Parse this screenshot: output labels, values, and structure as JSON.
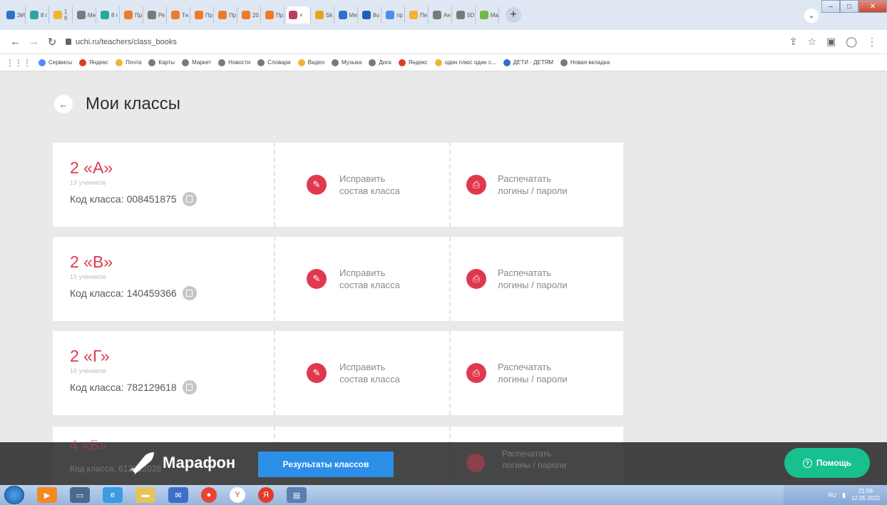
{
  "browser": {
    "tabs": [
      {
        "label": "ЭИ",
        "color": "#2f6fd0"
      },
      {
        "label": "8 г",
        "color": "#2aa6a0"
      },
      {
        "label": "1 б",
        "color": "#f2b233"
      },
      {
        "label": "Ме",
        "color": "#7a7a7a"
      },
      {
        "label": "8 г",
        "color": "#2aa6a0"
      },
      {
        "label": "Пр",
        "color": "#f07a28"
      },
      {
        "label": "Ре",
        "color": "#7a7a7a"
      },
      {
        "label": "Тн",
        "color": "#f07a28"
      },
      {
        "label": "Пр",
        "color": "#f07a28"
      },
      {
        "label": "Пр",
        "color": "#f07a28"
      },
      {
        "label": "20",
        "color": "#f07a28"
      },
      {
        "label": "Пр",
        "color": "#f07a28"
      },
      {
        "label": "×",
        "color": "#c23b5a"
      },
      {
        "label": "Sk",
        "color": "#e6a51d"
      },
      {
        "label": "Ме",
        "color": "#2f6fd0"
      },
      {
        "label": "8о",
        "color": "#1f5fb5"
      },
      {
        "label": "пр",
        "color": "#4c8df0"
      },
      {
        "label": "Пе",
        "color": "#f2b233"
      },
      {
        "label": "Ан",
        "color": "#7a7a7a"
      },
      {
        "label": "5D",
        "color": "#7a7a7a"
      },
      {
        "label": "Ма",
        "color": "#74b843"
      }
    ],
    "url": "uchi.ru/teachers/class_books",
    "bookmarks": [
      {
        "label": "Сервисы",
        "color": "#4c8df0"
      },
      {
        "label": "Яндекс",
        "color": "#e03a2b"
      },
      {
        "label": "Почта",
        "color": "#f2b233"
      },
      {
        "label": "Карты",
        "color": "#7a7a7a"
      },
      {
        "label": "Маркет",
        "color": "#7a7a7a"
      },
      {
        "label": "Новости",
        "color": "#7a7a7a"
      },
      {
        "label": "Словари",
        "color": "#7a7a7a"
      },
      {
        "label": "Видео",
        "color": "#f2b233"
      },
      {
        "label": "Музыка",
        "color": "#7a7a7a"
      },
      {
        "label": "Диск",
        "color": "#7a7a7a"
      },
      {
        "label": "Яндекс",
        "color": "#e03a2b"
      },
      {
        "label": "один плюс один с...",
        "color": "#f2b233"
      },
      {
        "label": "ДЕТИ - ДЕТЯМ",
        "color": "#2f6fd0"
      },
      {
        "label": "Новая вкладка",
        "color": "#7a7a7a"
      }
    ]
  },
  "page": {
    "title": "Мои классы",
    "edit_label_1": "Исправить",
    "edit_label_2": "состав класса",
    "print_label_1": "Распечатать",
    "print_label_2": "логины / пароли",
    "code_prefix": "Код класса:",
    "classes": [
      {
        "name": "2 «А»",
        "count": "19 учеников",
        "code": "008451875"
      },
      {
        "name": "2 «В»",
        "count": "15 учеников",
        "code": "140459366"
      },
      {
        "name": "2 «Г»",
        "count": "16 учеников",
        "code": "782129618"
      }
    ],
    "partial_class": {
      "name": "4 «Б»",
      "code": "Код класса: 612612028"
    }
  },
  "marathon": {
    "title": "Марафон",
    "results_button": "Результаты классов",
    "help_button": "Помощь"
  },
  "taskbar": {
    "time": "21:09",
    "date": "12.05.2022",
    "lang": "RU"
  },
  "accent_color": "#e0394f"
}
